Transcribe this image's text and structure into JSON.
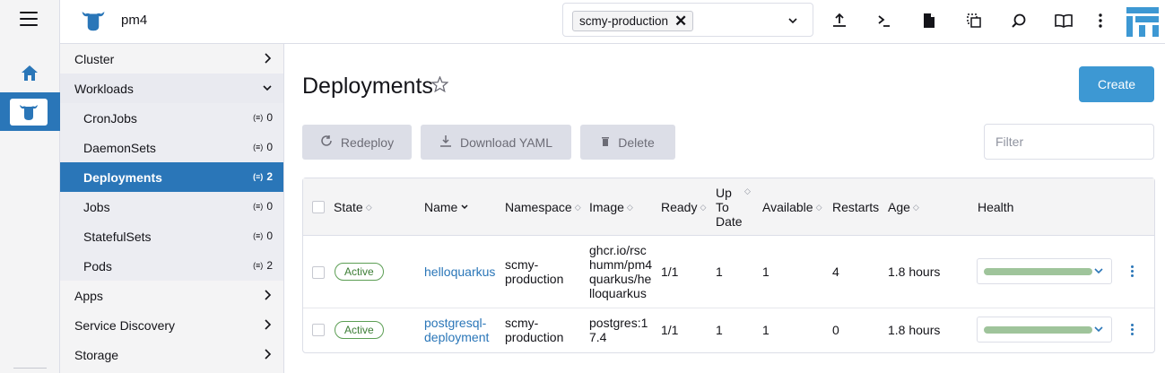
{
  "header": {
    "cluster_name": "pm4",
    "namespace_chip": "scmy-production",
    "icons": [
      "import-yaml-icon",
      "kubectl-shell-icon",
      "kubeconfig-download-icon",
      "copy-kubeconfig-icon",
      "search-icon",
      "docs-icon",
      "more-vert-icon"
    ]
  },
  "sidebar": {
    "items": [
      {
        "label": "Cluster",
        "type": "group"
      },
      {
        "label": "Workloads",
        "type": "group-open"
      },
      {
        "label": "CronJobs",
        "count": "0"
      },
      {
        "label": "DaemonSets",
        "count": "0"
      },
      {
        "label": "Deployments",
        "count": "2"
      },
      {
        "label": "Jobs",
        "count": "0"
      },
      {
        "label": "StatefulSets",
        "count": "0"
      },
      {
        "label": "Pods",
        "count": "2"
      },
      {
        "label": "Apps",
        "type": "group"
      },
      {
        "label": "Service Discovery",
        "type": "group"
      },
      {
        "label": "Storage",
        "type": "group"
      }
    ]
  },
  "main": {
    "title": "Deployments",
    "create_label": "Create",
    "redeploy_label": "Redeploy",
    "download_label": "Download YAML",
    "delete_label": "Delete",
    "filter_placeholder": "Filter"
  },
  "table": {
    "headers": {
      "state": "State",
      "name": "Name",
      "namespace": "Namespace",
      "image": "Image",
      "ready": "Ready",
      "uptodate_1": "Up",
      "uptodate_2": "To",
      "uptodate_3": "Date",
      "available": "Available",
      "restarts": "Restarts",
      "age": "Age",
      "health": "Health"
    },
    "rows": [
      {
        "state": "Active",
        "name": "helloquarkus",
        "namespace_1": "scmy-",
        "namespace_2": "production",
        "image_1": "ghcr.io/rsc",
        "image_2": "humm/pm4",
        "image_3": "quarkus/he",
        "image_4": "lloquarkus",
        "ready": "1/1",
        "uptodate": "1",
        "available": "1",
        "restarts": "4",
        "age": "1.8 hours"
      },
      {
        "state": "Active",
        "name_1": "postgresql-",
        "name_2": "deployment",
        "namespace_1": "scmy-",
        "namespace_2": "production",
        "image_1": "postgres:1",
        "image_2": "7.4",
        "ready": "1/1",
        "uptodate": "1",
        "available": "1",
        "restarts": "0",
        "age": "1.8 hours"
      }
    ]
  },
  "colors": {
    "accent": "#2a76b8",
    "create_button": "#3d98d3",
    "active_badge": "#3b7d34",
    "health_bar": "#9fc49b"
  }
}
